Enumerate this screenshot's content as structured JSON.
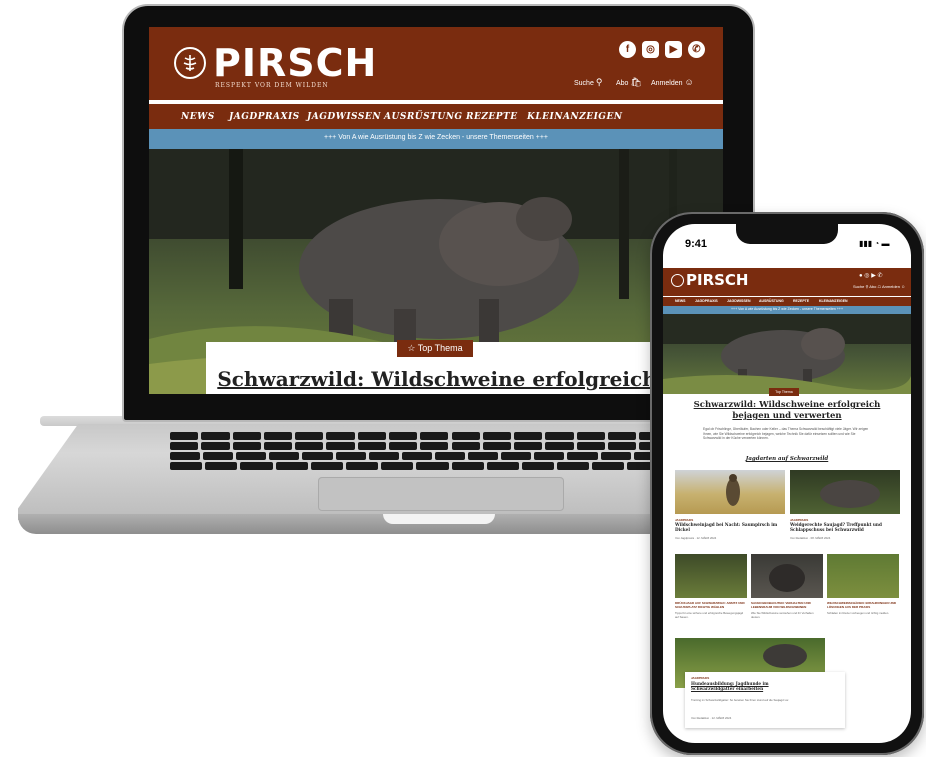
{
  "colors": {
    "brand_brown": "#7a2c0f",
    "strip_blue": "#5b92b8"
  },
  "laptop_site": {
    "logo_text": "PIRSCH",
    "tagline": "RESPEKT VOR DEM WILDEN",
    "social": [
      "facebook-icon",
      "instagram-icon",
      "youtube-icon",
      "whatsapp-icon"
    ],
    "util": {
      "search": "Suche",
      "abo": "Abo",
      "login": "Anmelden"
    },
    "nav": [
      "NEWS",
      "JAGDPRAXIS",
      "JAGDWISSEN",
      "AUSRÜSTUNG",
      "REZEPTE",
      "KLEINANZEIGEN"
    ],
    "strip": "+++ Von A wie Ausrüstung bis Z wie Zecken - unsere Themenseiten +++",
    "badge": "Top Thema",
    "title": "Schwarzwild: Wildschweine erfolgreich"
  },
  "phone_site": {
    "time": "9:41",
    "logo_text": "PIRSCH",
    "nav": [
      "NEWS",
      "JAGDPRAXIS",
      "JAGDWISSEN",
      "AUSRÜSTUNG",
      "REZEPTE",
      "KLEINANZEIGEN"
    ],
    "strip": "+++ Von A wie Ausrüstung bis Z wie Zecken - unsere Themenseiten +++",
    "badge": "Top Thema",
    "title_line1": "Schwarzwild: Wildschweine erfolgreich",
    "title_line2": "bejagen und verwerten",
    "intro": "Egal ob Frischlinge, Überläufer, Bachen oder Keiler – das Thema Schwarzwild beschäftigt viele Jäger. Wir zeigen Ihnen, wie Sie Wildschweine erfolgreich bejagen, welche Technik Sie dafür einsetzen sollten und wie Sie Schwarzwild in der Küche verwerten können.",
    "section": "Jagdarten auf Schwarzwild",
    "articles_top": [
      {
        "category": "JAGDPRAXIS",
        "title": "Wildschweinjagd bei Nacht: Saumpirsch im Dickel",
        "meta": "Von Jagdpraxis · 12. MÄRZ 2024"
      },
      {
        "category": "JAGDPRAXIS",
        "title": "Weidgerechte Saujagd? Treffpunkt und Schlappschuss bei Schwarzwild",
        "meta": "Von Redaktion · 08. MÄRZ 2024"
      }
    ],
    "articles_mid": [
      {
        "title": "DRÜCKJAGD AUF SCHWARZWILD: ANSITZ UND SCHUSSPLATZ RICHTIG WÄHLEN",
        "text": "Tipps für eine sichere und erfolgreiche Bewegungsjagd auf Sauen."
      },
      {
        "title": "SAUEN BEOBACHTEN: VERHALTEN UND LEBENSRAUM VON WILDSCHWEINEN",
        "text": "Wie Sie Wildschweine verstehen und ihr Verhalten deuten."
      },
      {
        "title": "WILDSCHWEINSCHÄDEN: ERFAHRUNGEN UND LÖSUNGEN AUS DER PRAXIS",
        "text": "Schäden im Revier vorbeugen und richtig melden."
      }
    ],
    "bottom_card": {
      "category": "JAGDPRAXIS",
      "title_line1": "Hundeausbildung: Jagdhunde im",
      "title_line2": "Schwarzwildgatter einarbeiten",
      "text": "Training im Schwarzwildgatter: So bereiten Sie Ihren Hund auf die Saujagd vor.",
      "meta": "Von Redaktion · 12. MÄRZ 2024"
    }
  }
}
